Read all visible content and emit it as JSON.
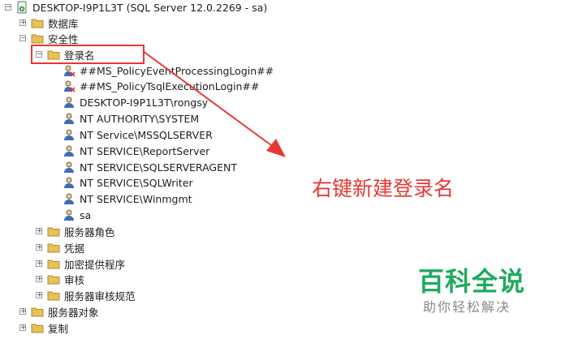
{
  "root": {
    "label": "DESKTOP-I9P1L3T (SQL Server 12.0.2269 - sa)",
    "expander": "−"
  },
  "nodes": {
    "databases": {
      "label": "数据库",
      "expander": "+"
    },
    "security": {
      "label": "安全性",
      "expander": "−"
    },
    "logins": {
      "label": "登录名",
      "expander": "−"
    },
    "server_roles": {
      "label": "服务器角色",
      "expander": "+"
    },
    "credentials": {
      "label": "凭据",
      "expander": "+"
    },
    "crypto_providers": {
      "label": "加密提供程序",
      "expander": "+"
    },
    "audits": {
      "label": "审核",
      "expander": "+"
    },
    "audit_specs": {
      "label": "服务器审核规范",
      "expander": "+"
    },
    "server_objects": {
      "label": "服务器对象",
      "expander": "+"
    },
    "replication": {
      "label": "复制",
      "expander": "+"
    }
  },
  "logins": [
    {
      "label": "##MS_PolicyEventProcessingLogin##",
      "disabled": true
    },
    {
      "label": "##MS_PolicyTsqlExecutionLogin##",
      "disabled": true
    },
    {
      "label": "DESKTOP-I9P1L3T\\rongsy",
      "disabled": false
    },
    {
      "label": "NT AUTHORITY\\SYSTEM",
      "disabled": false
    },
    {
      "label": "NT Service\\MSSQLSERVER",
      "disabled": false
    },
    {
      "label": "NT SERVICE\\ReportServer",
      "disabled": false
    },
    {
      "label": "NT SERVICE\\SQLSERVERAGENT",
      "disabled": false
    },
    {
      "label": "NT SERVICE\\SQLWriter",
      "disabled": false
    },
    {
      "label": "NT SERVICE\\Winmgmt",
      "disabled": false
    },
    {
      "label": "sa",
      "disabled": false
    }
  ],
  "annotation": {
    "text": "右键新建登录名"
  },
  "watermark": {
    "title": "百科全说",
    "subtitle": "助你轻松解决"
  },
  "colors": {
    "highlight": "#e53935",
    "folder": "#e8c05a",
    "watermark": "#1faa5e"
  }
}
